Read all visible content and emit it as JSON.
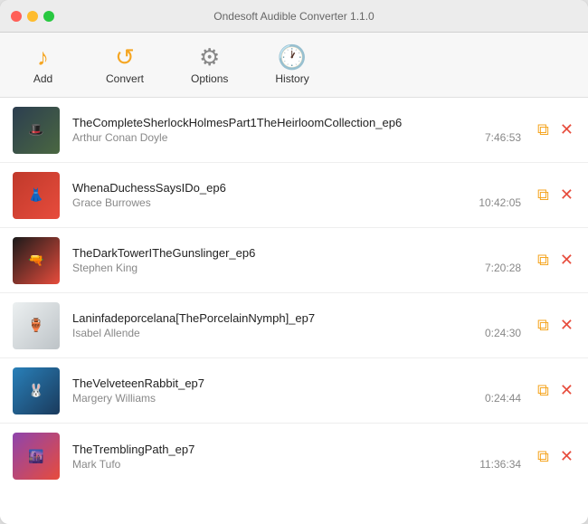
{
  "window": {
    "title": "Ondesoft Audible Converter 1.1.0"
  },
  "toolbar": {
    "add_label": "Add",
    "convert_label": "Convert",
    "options_label": "Options",
    "history_label": "History"
  },
  "items": [
    {
      "title": "TheCompleteSherlockHolmesPart1TheHeirloomCollection_ep6",
      "author": "Arthur Conan Doyle",
      "duration": "7:46:53",
      "art_class": "art-1",
      "art_emoji": "🎩"
    },
    {
      "title": "WhenaDuchessSaysIDo_ep6",
      "author": "Grace Burrowes",
      "duration": "10:42:05",
      "art_class": "art-2",
      "art_emoji": "👗"
    },
    {
      "title": "TheDarkTowerITheGunslinger_ep6",
      "author": "Stephen King",
      "duration": "7:20:28",
      "art_class": "art-3",
      "art_emoji": "🔫"
    },
    {
      "title": "Laninfadeporcelana[ThePorcelainNymph]_ep7",
      "author": "Isabel Allende",
      "duration": "0:24:30",
      "art_class": "art-4",
      "art_emoji": "🏺"
    },
    {
      "title": "TheVelveteenRabbit_ep7",
      "author": "Margery Williams",
      "duration": "0:24:44",
      "art_class": "art-5",
      "art_emoji": "🐰"
    },
    {
      "title": "TheTremblingPath_ep7",
      "author": "Mark Tufo",
      "duration": "11:36:34",
      "art_class": "art-6",
      "art_emoji": "🌆"
    }
  ],
  "actions": {
    "edit_icon": "✎",
    "delete_icon": "✕"
  }
}
